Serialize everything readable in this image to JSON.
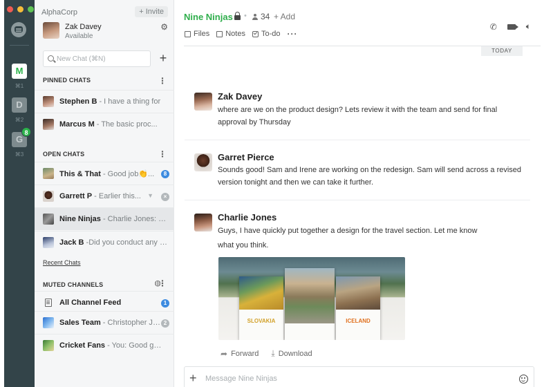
{
  "workspace": {
    "org_tiles": [
      {
        "letter": "M",
        "shortcut": "⌘1"
      },
      {
        "letter": "D",
        "shortcut": "⌘2"
      },
      {
        "letter": "G",
        "shortcut": "⌘3",
        "badge": "8"
      }
    ]
  },
  "sidebar": {
    "company": "AlphaCorp",
    "invite_label": "+ Invite",
    "user": {
      "name": "Zak Davey",
      "status": "Available"
    },
    "search_placeholder": "New Chat (⌘N)",
    "add_label": "+",
    "pinned": {
      "title": "PINNED CHATS",
      "items": [
        {
          "name": "Stephen B",
          "preview": " - I have a thing for"
        },
        {
          "name": "Marcus M",
          "preview": " - The basic proc..."
        }
      ]
    },
    "open": {
      "title": "OPEN CHATS",
      "items": [
        {
          "name": "This & That",
          "preview": " - Good job👏...",
          "badge": "8"
        },
        {
          "name": "Garrett P",
          "preview": " - Earlier this..."
        },
        {
          "name": "Nine Ninjas",
          "preview": " - Charlie Jones: G..."
        },
        {
          "name": "Jack B",
          "preview": " -Did you conduct any sur"
        }
      ]
    },
    "recent_link": "Recent Chats",
    "muted": {
      "title": "MUTED CHANNELS",
      "items": [
        {
          "name": "All Channel Feed",
          "preview": "",
          "badge": "1"
        },
        {
          "name": "Sales Team",
          "preview": " - Christopher J: d...",
          "badge": "2"
        },
        {
          "name": "Cricket Fans",
          "preview": " - You: Good game"
        }
      ]
    }
  },
  "channel": {
    "name": "Nine Ninjas",
    "member_count": "34",
    "add_label": "+ Add",
    "tabs": [
      "Files",
      "Notes",
      "To-do"
    ],
    "more": "···",
    "date_divider": "TODAY"
  },
  "messages": [
    {
      "author": "Zak Davey",
      "text": "where are we on the product design? Lets review it with the team and send for final approval by Thursday"
    },
    {
      "author": "Garret Pierce",
      "text": "Sounds good! Sam and Irene are working on the redesign. Sam will send across a revised version tonight and then we can take it further."
    },
    {
      "author": "Charlie Jones",
      "text": "Guys, I have quickly put together a design for the travel section. Let me know what you think."
    }
  ],
  "attachment": {
    "posters": [
      {
        "title": "SLOVAKIA",
        "color": "#d2a12a"
      },
      {
        "title": "",
        "color": "#333333"
      },
      {
        "title": "ICELAND",
        "color": "#e0701e"
      }
    ],
    "actions": {
      "forward": "Forward",
      "download": "Download"
    }
  },
  "composer": {
    "placeholder": "Message Nine Ninjas"
  }
}
